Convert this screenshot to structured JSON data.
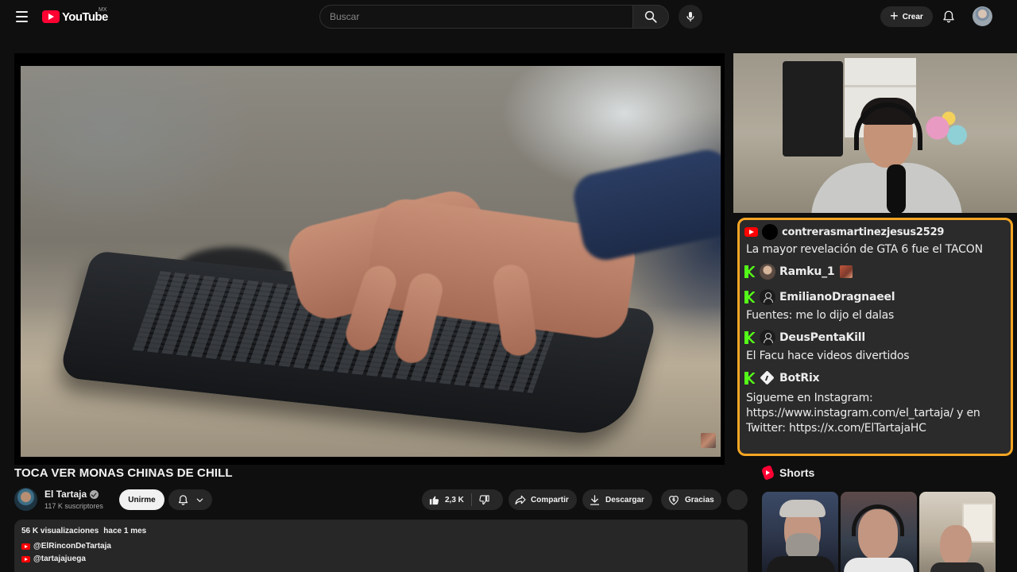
{
  "header": {
    "logo_text": "YouTube",
    "country_code": "MX",
    "search_placeholder": "Buscar",
    "create_label": "Crear"
  },
  "chat": {
    "messages": [
      {
        "platform": "youtube",
        "user": "contrerasmartinezjesus2529",
        "text": "La mayor revelación de GTA 6 fue el TACON"
      },
      {
        "platform": "kick",
        "user": "Ramku_1",
        "text": ""
      },
      {
        "platform": "kick",
        "user": "EmilianoDragnaeel",
        "text": "Fuentes: me lo dijo el dalas"
      },
      {
        "platform": "kick",
        "user": "DeusPentaKill",
        "text": "El Facu hace videos divertidos"
      },
      {
        "platform": "kick",
        "user": "BotRix",
        "text": "Sigueme en Instagram: https://www.instagram.com/el_tartaja/ y en Twitter: https://x.com/ElTartajaHC"
      }
    ]
  },
  "video": {
    "title": "TOCA VER MONAS CHINAS DE CHILL",
    "channel_name": "El Tartaja",
    "subscribers": "117 K suscriptores",
    "join_label": "Unirme",
    "likes": "2,3 K",
    "share_label": "Compartir",
    "download_label": "Descargar",
    "thanks_label": "Gracias"
  },
  "description": {
    "views": "56 K visualizaciones",
    "date": "hace 1 mes",
    "links": [
      "@ElRinconDeTartaja",
      "@tartajajuega"
    ]
  },
  "shorts": {
    "title": "Shorts"
  },
  "colors": {
    "background": "#0f0f0f",
    "youtube_red": "#ff0033",
    "chat_border": "#f5a623",
    "kick_green": "#53fc18",
    "pill_bg": "#272727"
  }
}
